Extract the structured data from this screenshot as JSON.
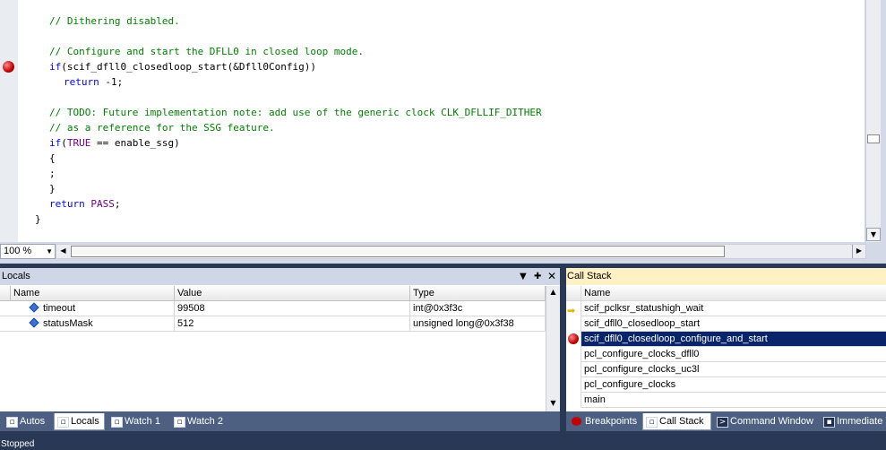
{
  "editor": {
    "lines": [
      {
        "top": "// Dithering disabled."
      },
      {
        "text": "// Configure and start the DFLL0 in closed loop mode."
      },
      {
        "text": "if(scif_dfll0_closedloop_start(&Dfll0Config))"
      },
      {
        "text": "return -1;"
      },
      {
        "text": "// TODO: Future implementation note: add use of the generic clock CLK_DFLLIF_DITHER"
      },
      {
        "text": "// as a reference for the SSG feature."
      },
      {
        "text": "if(TRUE == enable_ssg)"
      },
      {
        "text": "{"
      },
      {
        "text": ";"
      },
      {
        "text": "}"
      },
      {
        "text": "return PASS;"
      },
      {
        "text": "}"
      }
    ],
    "zoom": "100 %"
  },
  "locals": {
    "title": "Locals",
    "columns": [
      "Name",
      "Value",
      "Type"
    ],
    "rows": [
      {
        "name": "timeout",
        "value": "99508",
        "type": "int@0x3f3c"
      },
      {
        "name": "statusMask",
        "value": "512",
        "type": "unsigned long@0x3f38"
      }
    ]
  },
  "callstack": {
    "title": "Call Stack",
    "column": "Name",
    "frames": [
      "scif_pclksr_statushigh_wait",
      "scif_dfll0_closedloop_start",
      "scif_dfll0_closedloop_configure_and_start",
      "pcl_configure_clocks_dfll0",
      "pcl_configure_clocks_uc3l",
      "pcl_configure_clocks",
      "main"
    ]
  },
  "left_tabs": [
    "Autos",
    "Locals",
    "Watch 1",
    "Watch 2"
  ],
  "right_tabs": [
    "Breakpoints",
    "Call Stack",
    "Command Window",
    "Immediate"
  ],
  "status": "Stopped"
}
